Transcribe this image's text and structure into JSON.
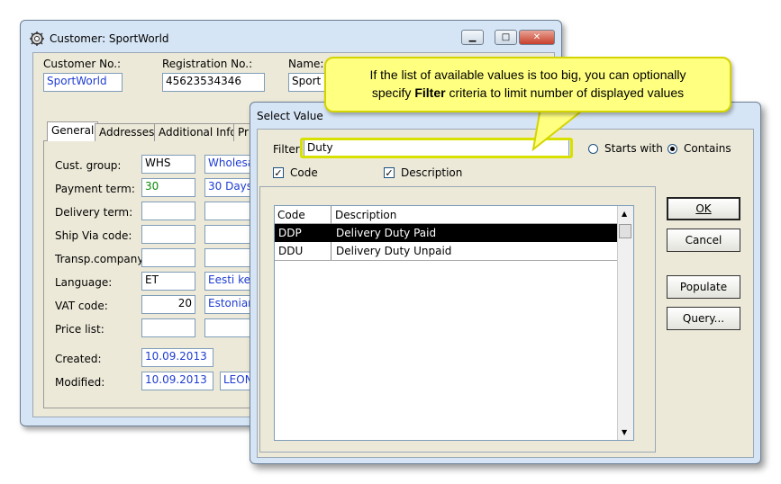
{
  "customer_window": {
    "title": "Customer: SportWorld",
    "fields": {
      "customer_no_label": "Customer No.:",
      "customer_no": "SportWorld",
      "registration_no_label": "Registration No.:",
      "registration_no": "45623534346",
      "name_label": "Name:",
      "name": "Sport W"
    },
    "tabs": [
      "General",
      "Addresses",
      "Additional Info",
      "Pr"
    ],
    "general": {
      "cust_group_label": "Cust. group:",
      "cust_group": "WHS",
      "cust_group_desc": "Wholesa",
      "payment_term_label": "Payment term:",
      "payment_term": "30",
      "payment_term_desc": "30 Days",
      "delivery_term_label": "Delivery term:",
      "ship_via_label": "Ship Via code:",
      "transp_company_label": "Transp.company:",
      "language_label": "Language:",
      "language": "ET",
      "language_desc": "Eesti kee",
      "vat_code_label": "VAT code:",
      "vat_code": "20",
      "vat_code_desc": "Estonian",
      "price_list_label": "Price list:",
      "created_label": "Created:",
      "created": "10.09.2013",
      "modified_label": "Modified:",
      "modified": "10.09.2013",
      "modified_by": "LEON"
    }
  },
  "select_value_dialog": {
    "title": "Select Value",
    "filter_label": "Filter:",
    "filter_value": "Duty",
    "starts_with_label": "Starts with",
    "contains_label": "Contains",
    "code_check_label": "Code",
    "description_check_label": "Description",
    "columns": [
      "Code",
      "Description"
    ],
    "rows": [
      {
        "code": "DDP",
        "description": "Delivery Duty Paid"
      },
      {
        "code": "DDU",
        "description": "Delivery Duty Unpaid"
      }
    ],
    "buttons": {
      "ok": "OK",
      "cancel": "Cancel",
      "populate": "Populate",
      "query": "Query..."
    }
  },
  "callout": {
    "line1": "If the list of available values is too big, you can optionally",
    "line2_pre": "specify ",
    "line2_bold": "Filter",
    "line2_post": " criteria to limit number of displayed values"
  },
  "colors": {
    "title_bar": "#d6e5f5",
    "client": "#ece9d8",
    "field_blue_text": "#1e3cd2",
    "callout_fill": "#ffff80",
    "highlight": "#d8e000"
  }
}
